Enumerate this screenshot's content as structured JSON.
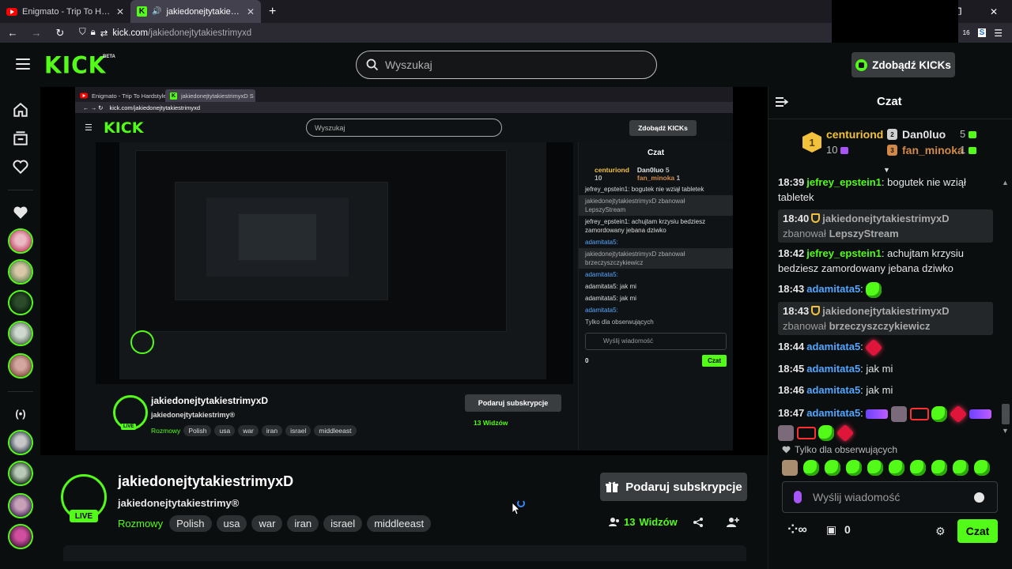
{
  "browser": {
    "tabs": [
      {
        "title": "Enigmato - Trip To Hardstyl",
        "favicon": "youtube-favicon"
      },
      {
        "title": "jakiedonejtytakiestrimyxD S",
        "favicon": "kick-favicon"
      }
    ],
    "url_host": "kick.com",
    "url_path": "/jakiedonejtytakiestrimyxd",
    "ext_badge": "16"
  },
  "header": {
    "logo": "KICK",
    "beta": "BETA",
    "search_placeholder": "Wyszukaj",
    "get_kicks_label": "Zdobądź KICKs"
  },
  "nested_capture": {
    "tab1": "Enigmato - Trip To Hardstyle",
    "tab2": "jakiedonejtytakiestrimyxD S",
    "url": "kick.com/jakiedonejtytakiestrimyxd",
    "logo": "KICK",
    "search": "Wyszukaj",
    "kicks": "Zdobądź KICKs",
    "chat_title": "Czat",
    "lb1": "centuriond",
    "lb1_count": "10",
    "lb2": "Dan0luo",
    "lb2_count": "5",
    "lb3": "fan_minoka",
    "lb3_count": "1",
    "msg1": "jefrey_epstein1: bogutek nie wziął tabletek",
    "msg2": "jakiedonejtytakiestrimyxD zbanował LepszyStream",
    "msg3": "jefrey_epstein1: achujtam krzysiu bedziesz zamordowany jebana dziwko",
    "msg4": "adamitata5:",
    "msg5": "jakiedonejtytakiestrimyxD zbanował brzeczyszczykiewicz",
    "msg6": "adamitata5:",
    "msg7": "adamitata5: jak mi",
    "msg8": "adamitata5: jak mi",
    "msg9": "adamitata5:",
    "followers": "Tylko dla obserwujących",
    "input": "Wyślij wiadomość",
    "send": "Czat",
    "title": "jakiedonejtytakiestrimyxD",
    "sub": "jakiedonejtytakiestrimy®",
    "category": "Rozmowy",
    "tags": [
      "Polish",
      "usa",
      "war",
      "iran",
      "israel",
      "middleeast"
    ],
    "sub_btn": "Podaruj subskrypcje",
    "viewers_num": "13",
    "viewers": "Widzów",
    "live": "LIVE",
    "bottom_count": "0"
  },
  "stream": {
    "title": "jakiedonejtytakiestrimyxD",
    "username": "jakiedonejtytakiestrimy®",
    "live_label": "LIVE",
    "category": "Rozmowy",
    "tags": [
      "Polish",
      "usa",
      "war",
      "iran",
      "israel",
      "middleeast"
    ],
    "gift_sub_label": "Podaruj subskrypcje",
    "viewers_count": "13",
    "viewers_label": "Widzów"
  },
  "chat": {
    "title": "Czat",
    "leaderboard": [
      {
        "rank": "1",
        "name": "centuriond",
        "count": "10",
        "color": "#f3c23c"
      },
      {
        "rank": "2",
        "name": "Dan0luo",
        "count": "5",
        "color": "#d0d0d0"
      },
      {
        "rank": "3",
        "name": "fan_minoka",
        "count": "1",
        "color": "#d08947"
      }
    ],
    "messages": [
      {
        "time": "18:39",
        "user": "jefrey_epstein1",
        "text": ": bogutek nie wziął tabletek"
      },
      {
        "time": "18:40",
        "moderator": "jakiedonejtytakiestrimyxD",
        "action": "zbanował",
        "target": "LepszyStream"
      },
      {
        "time": "18:42",
        "user": "jefrey_epstein1",
        "text": ": achujtam krzysiu bedziesz zamordowany jebana dziwko"
      },
      {
        "time": "18:43",
        "user": "adamitata5",
        "text": ":"
      },
      {
        "time": "18:43",
        "moderator": "jakiedonejtytakiestrimyxD",
        "action": "zbanował",
        "target": "brzeczyszczykiewicz"
      },
      {
        "time": "18:44",
        "user": "adamitata5",
        "text": ":"
      },
      {
        "time": "18:45",
        "user": "adamitata5",
        "text": ": jak mi"
      },
      {
        "time": "18:46",
        "user": "adamitata5",
        "text": ": jak mi"
      },
      {
        "time": "18:47",
        "user": "adamitata5",
        "text": ":"
      }
    ],
    "followers_only": "Tylko dla obserwujących",
    "input_placeholder": "Wyślij wiadomość",
    "points": "0",
    "send_label": "Czat"
  },
  "colors": {
    "accent": "#53fc18",
    "background": "#0b0e0f",
    "username_blue": "#53a6ff",
    "first_place": "#f3c23c"
  }
}
